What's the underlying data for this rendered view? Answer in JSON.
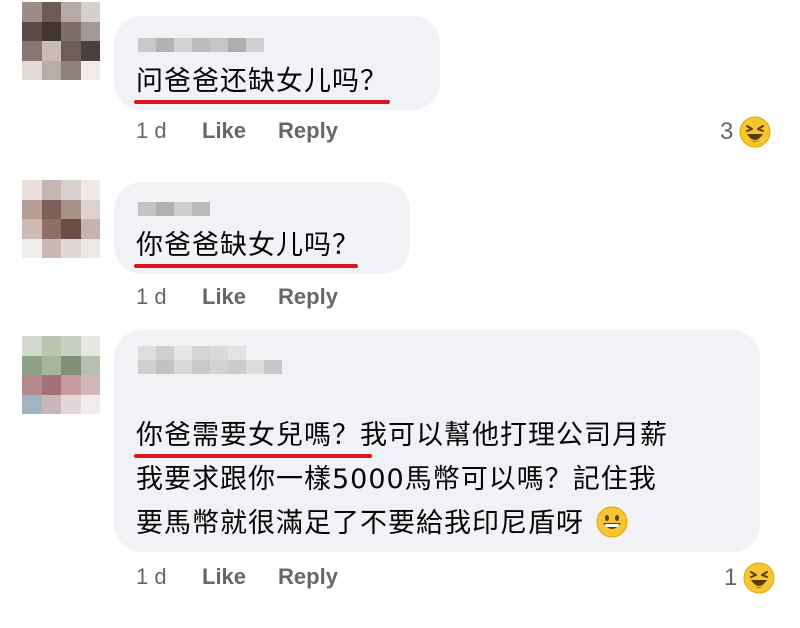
{
  "comments": [
    {
      "line1": "问爸爸还缺女儿吗？",
      "time": "1 d",
      "like": "Like",
      "reply": "Reply",
      "reaction_count": "3"
    },
    {
      "line1": "你爸爸缺女儿吗？",
      "time": "1 d",
      "like": "Like",
      "reply": "Reply"
    },
    {
      "line1": "你爸需要女兒嗎？我可以幫他打理公司月薪",
      "line2": "我要求跟你一樣5000馬幣可以嗎？記住我",
      "line3": "要馬幣就很滿足了不要給我印尼盾呀",
      "time": "1 d",
      "like": "Like",
      "reply": "Reply",
      "reaction_count": "1"
    }
  ],
  "colors": {
    "bubble": "#f0f2f5",
    "underline": "#e0141c",
    "meta": "#65676b"
  },
  "icons": {
    "reaction": "laughing-emoji-icon",
    "inline_emoji": "grinning-emoji-icon"
  }
}
